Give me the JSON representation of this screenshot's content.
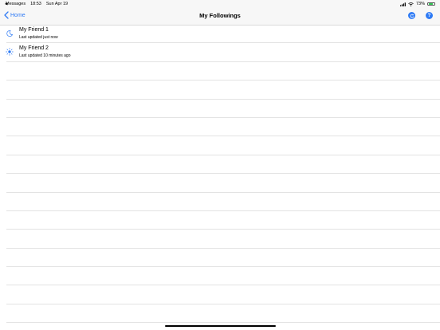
{
  "status_bar": {
    "back_app": "Messages",
    "time": "18:53",
    "date": "Sun Apr 19",
    "battery_percent_text": "73%",
    "battery_level": 0.73
  },
  "nav": {
    "back_label": "Home",
    "title": "My Followings",
    "refresh_icon": "refresh-icon",
    "help_label": "?"
  },
  "followings": [
    {
      "name": "My Friend 1",
      "updated": "Last updated just now",
      "icon": "moon-icon"
    },
    {
      "name": "My Friend 2",
      "updated": "Last updated  10 minutes ago",
      "icon": "sun-icon"
    }
  ],
  "colors": {
    "accent": "#2f7bf5",
    "battery": "#34c759"
  }
}
